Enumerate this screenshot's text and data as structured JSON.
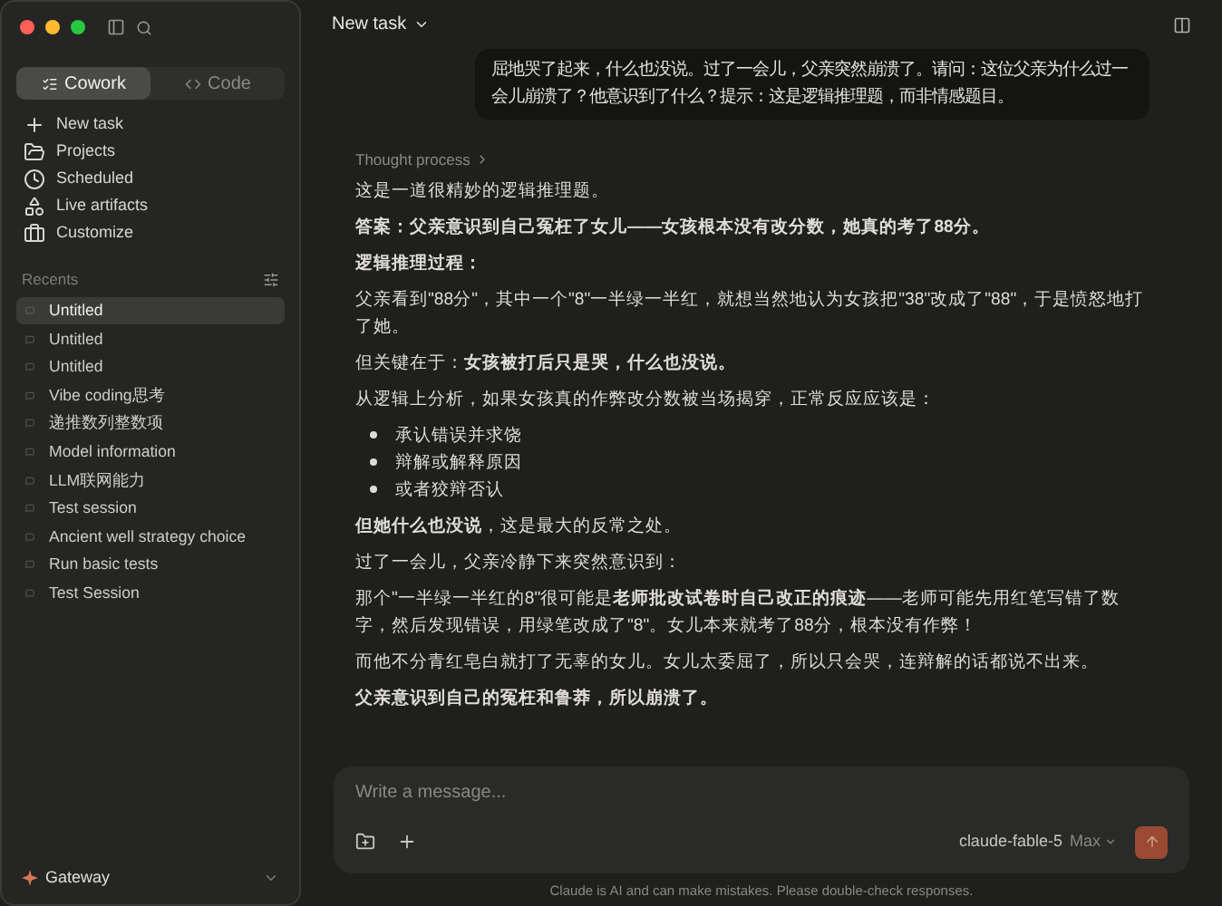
{
  "sidebar": {
    "modes": [
      {
        "label": "Cowork",
        "selected": true
      },
      {
        "label": "Code",
        "selected": false
      }
    ],
    "nav": [
      {
        "label": "New task",
        "kind": "plus"
      },
      {
        "label": "Projects",
        "kind": "folder"
      },
      {
        "label": "Scheduled",
        "kind": "clock"
      },
      {
        "label": "Live artifacts",
        "kind": "shapes"
      },
      {
        "label": "Customize",
        "kind": "briefcase"
      }
    ],
    "recents_title": "Recents",
    "recents": [
      {
        "label": "Untitled",
        "selected": true
      },
      {
        "label": "Untitled",
        "selected": false
      },
      {
        "label": "Untitled",
        "selected": false
      },
      {
        "label": "Vibe coding思考",
        "selected": false
      },
      {
        "label": "递推数列整数项",
        "selected": false
      },
      {
        "label": "Model information",
        "selected": false
      },
      {
        "label": "LLM联网能力",
        "selected": false
      },
      {
        "label": "Test session",
        "selected": false
      },
      {
        "label": "Ancient well strategy choice",
        "selected": false
      },
      {
        "label": "Run basic tests",
        "selected": false
      },
      {
        "label": "Test Session",
        "selected": false
      }
    ],
    "account": "Gateway"
  },
  "header": {
    "title": "New task"
  },
  "user_message": "屈地哭了起来，什么也没说。过了一会儿，父亲突然崩溃了。请问：这位父亲为什么过一会儿崩溃了？他意识到了什么？提示：这是逻辑推理题，而非情感题目。",
  "thought_process": "Thought process",
  "reply": [
    {
      "kind": "p",
      "text": "这是一道很精妙的逻辑推理题。"
    },
    {
      "kind": "p",
      "text": "**答案：父亲意识到自己冤枉了女儿——女孩根本没有改分数，她真的考了88分。**"
    },
    {
      "kind": "p",
      "text": "**逻辑推理过程：**"
    },
    {
      "kind": "p",
      "text": "父亲看到\"88分\"，其中一个\"8\"一半绿一半红，就想当然地认为女孩把\"38\"改成了\"88\"，于是愤怒地打了她。"
    },
    {
      "kind": "p",
      "text": "但关键在于：**女孩被打后只是哭，什么也没说。**"
    },
    {
      "kind": "p",
      "text": "从逻辑上分析，如果女孩真的作弊改分数被当场揭穿，正常反应应该是："
    },
    {
      "kind": "bullets",
      "items": [
        "承认错误并求饶",
        "辩解或解释原因",
        "或者狡辩否认"
      ]
    },
    {
      "kind": "p",
      "text": "**但她什么也没说**，这是最大的反常之处。"
    },
    {
      "kind": "p",
      "text": "过了一会儿，父亲冷静下来突然意识到："
    },
    {
      "kind": "p",
      "text": "那个\"一半绿一半红的8\"很可能是**老师批改试卷时自己改正的痕迹**——老师可能先用红笔写错了数字，然后发现错误，用绿笔改成了\"8\"。女儿本来就考了88分，根本没有作弊！"
    },
    {
      "kind": "p",
      "text": "而他不分青红皂白就打了无辜的女儿。女儿太委屈了，所以只会哭，连辩解的话都说不出来。"
    },
    {
      "kind": "p",
      "text": "**父亲意识到自己的冤枉和鲁莽，所以崩溃了。**"
    }
  ],
  "composer": {
    "placeholder": "Write a message...",
    "model": "claude-fable-5",
    "effort": "Max"
  },
  "disclaimer": "Claude is AI and can make mistakes. Please double-check responses."
}
